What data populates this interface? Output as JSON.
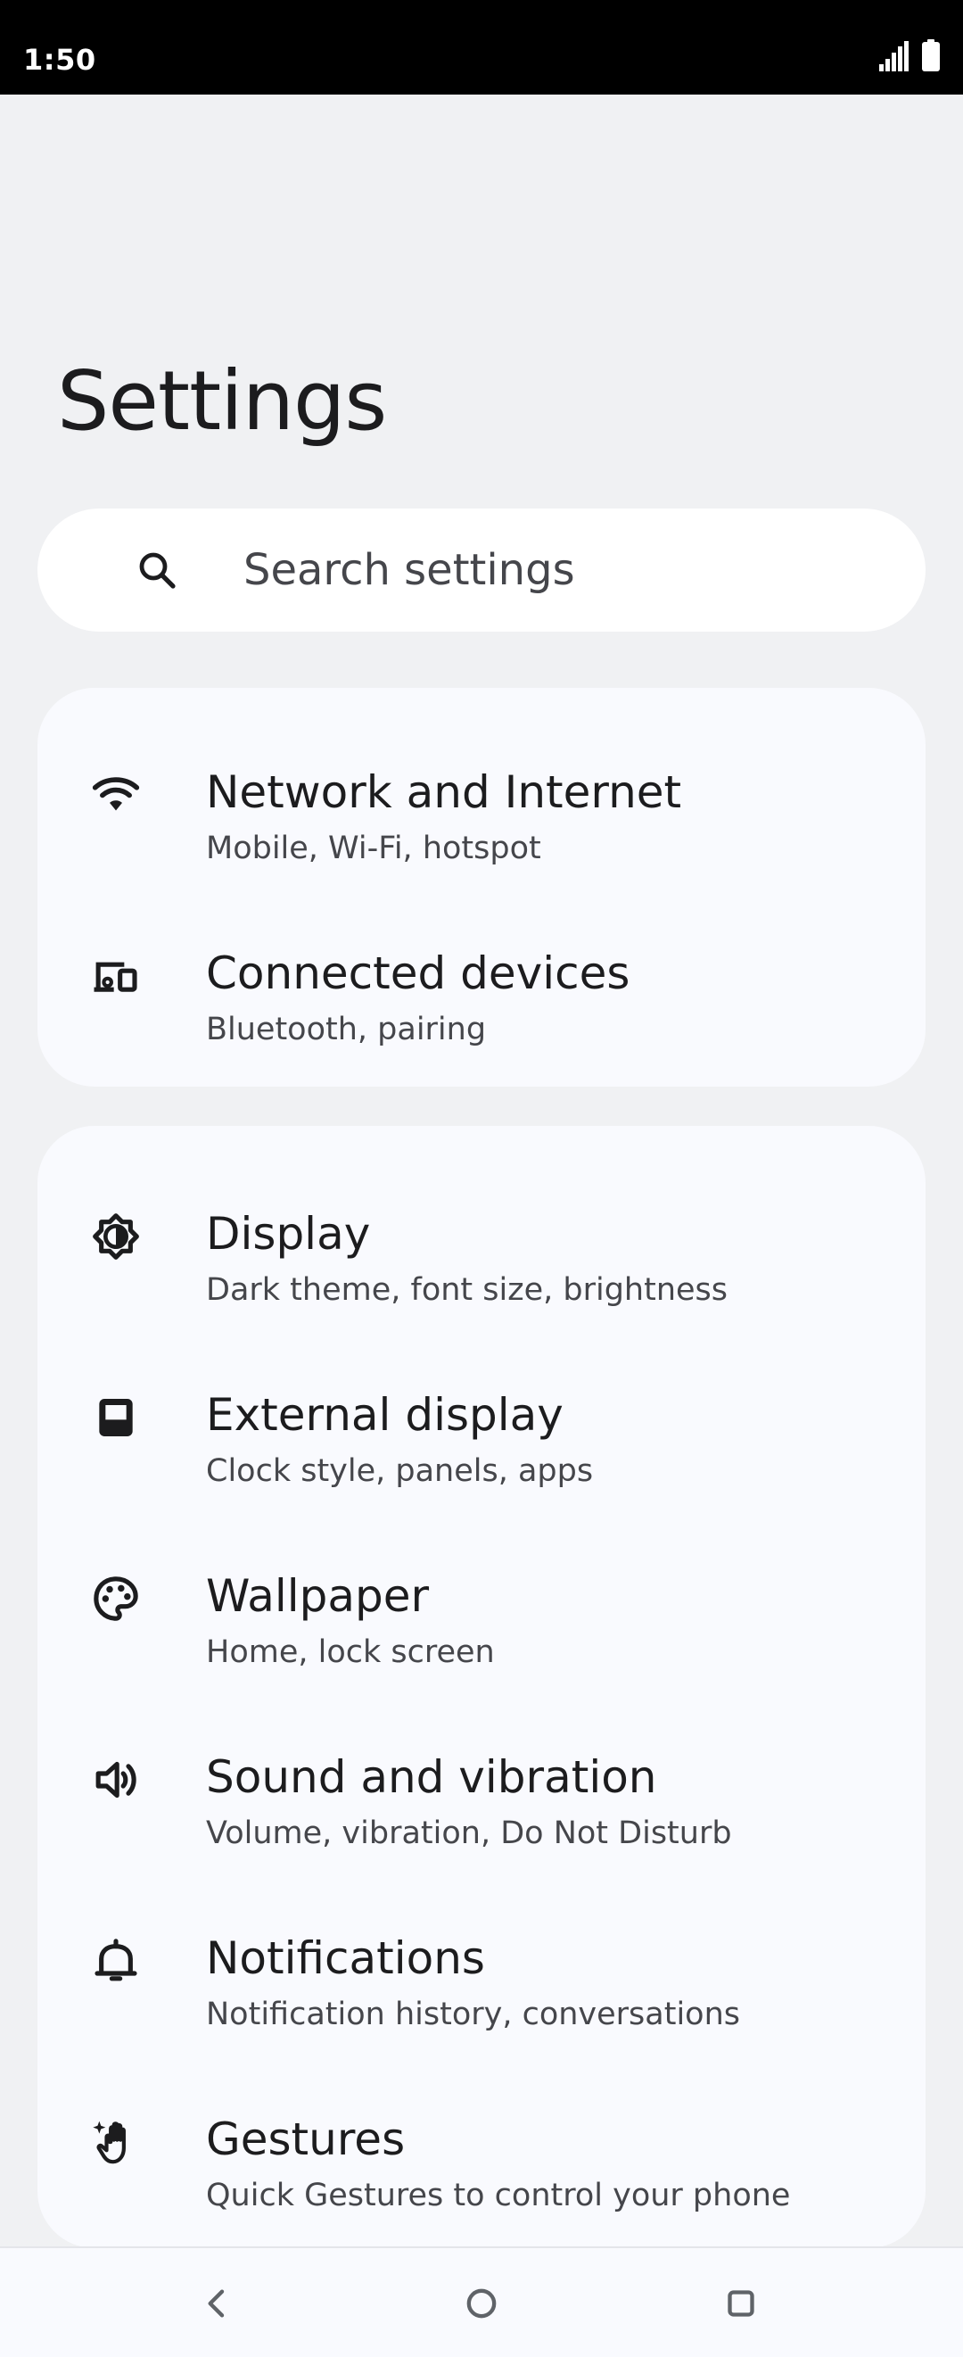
{
  "status_bar": {
    "time": "1:50"
  },
  "page": {
    "title": "Settings"
  },
  "search": {
    "placeholder": "Search settings"
  },
  "groups": [
    {
      "items": [
        {
          "icon": "wifi-icon",
          "title": "Network and Internet",
          "subtitle": "Mobile, Wi-Fi, hotspot"
        },
        {
          "icon": "connected-devices-icon",
          "title": "Connected devices",
          "subtitle": "Bluetooth, pairing"
        }
      ]
    },
    {
      "items": [
        {
          "icon": "brightness-icon",
          "title": "Display",
          "subtitle": "Dark theme, font size, brightness"
        },
        {
          "icon": "external-display-icon",
          "title": "External display",
          "subtitle": "Clock style, panels, apps"
        },
        {
          "icon": "palette-icon",
          "title": "Wallpaper",
          "subtitle": "Home, lock screen"
        },
        {
          "icon": "volume-icon",
          "title": "Sound and vibration",
          "subtitle": "Volume, vibration, Do Not Disturb"
        },
        {
          "icon": "bell-icon",
          "title": "Notifications",
          "subtitle": "Notification history, conversations"
        },
        {
          "icon": "gesture-hand-icon",
          "title": "Gestures",
          "subtitle": "Quick Gestures to control your phone"
        }
      ]
    }
  ],
  "colors": {
    "background": "#f0f1f3",
    "card": "#f9fafe",
    "text_primary": "#1c1c1e",
    "text_secondary": "#45464b"
  }
}
